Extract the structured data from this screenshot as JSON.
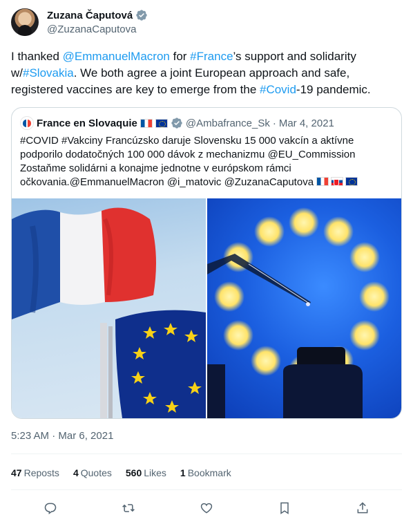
{
  "author": {
    "name": "Zuzana Čaputová",
    "handle": "@ZuzanaCaputova"
  },
  "tweet": {
    "t1": "I thanked ",
    "m1": "@EmmanuelMacron",
    "t2": " for ",
    "h1": "#France",
    "t3": "’s support and solidarity w/",
    "h2": "#Slovakia",
    "t4": ". We both agree a joint European approach and safe, registered vaccines are key to emerge from the ",
    "h3": "#Covid",
    "t5": "-19 pandemic."
  },
  "quote": {
    "name": "France en Slovaquie",
    "handle": "@Ambafrance_Sk",
    "sep": "·",
    "date": "Mar 4, 2021",
    "text": "#COVID #Vakciny Francúzsko daruje Slovensku 15 000 vakcín a aktívne podporilo dodatočných 100 000 dávok z mechanizmu @EU_Commission Zostaňme solidárni a konajme jednotne v európskom rámci očkovania.@EmmanuelMacron @i_matovic @ZuzanaCaputova"
  },
  "timestamp": "5:23 AM · Mar 6, 2021",
  "stats": {
    "reposts_count": "47",
    "reposts_label": "Reposts",
    "quotes_count": "4",
    "quotes_label": "Quotes",
    "likes_count": "560",
    "likes_label": "Likes",
    "bookmarks_count": "1",
    "bookmarks_label": "Bookmark"
  },
  "icons": {
    "verified": "verified-badge-icon",
    "reply": "reply-icon",
    "repost": "repost-icon",
    "like": "heart-icon",
    "bookmark": "bookmark-icon",
    "share": "share-icon"
  },
  "colors": {
    "link": "#1d9bf0",
    "secondary_text": "#536471",
    "border": "#cfd9de",
    "verified": "#829aab"
  }
}
